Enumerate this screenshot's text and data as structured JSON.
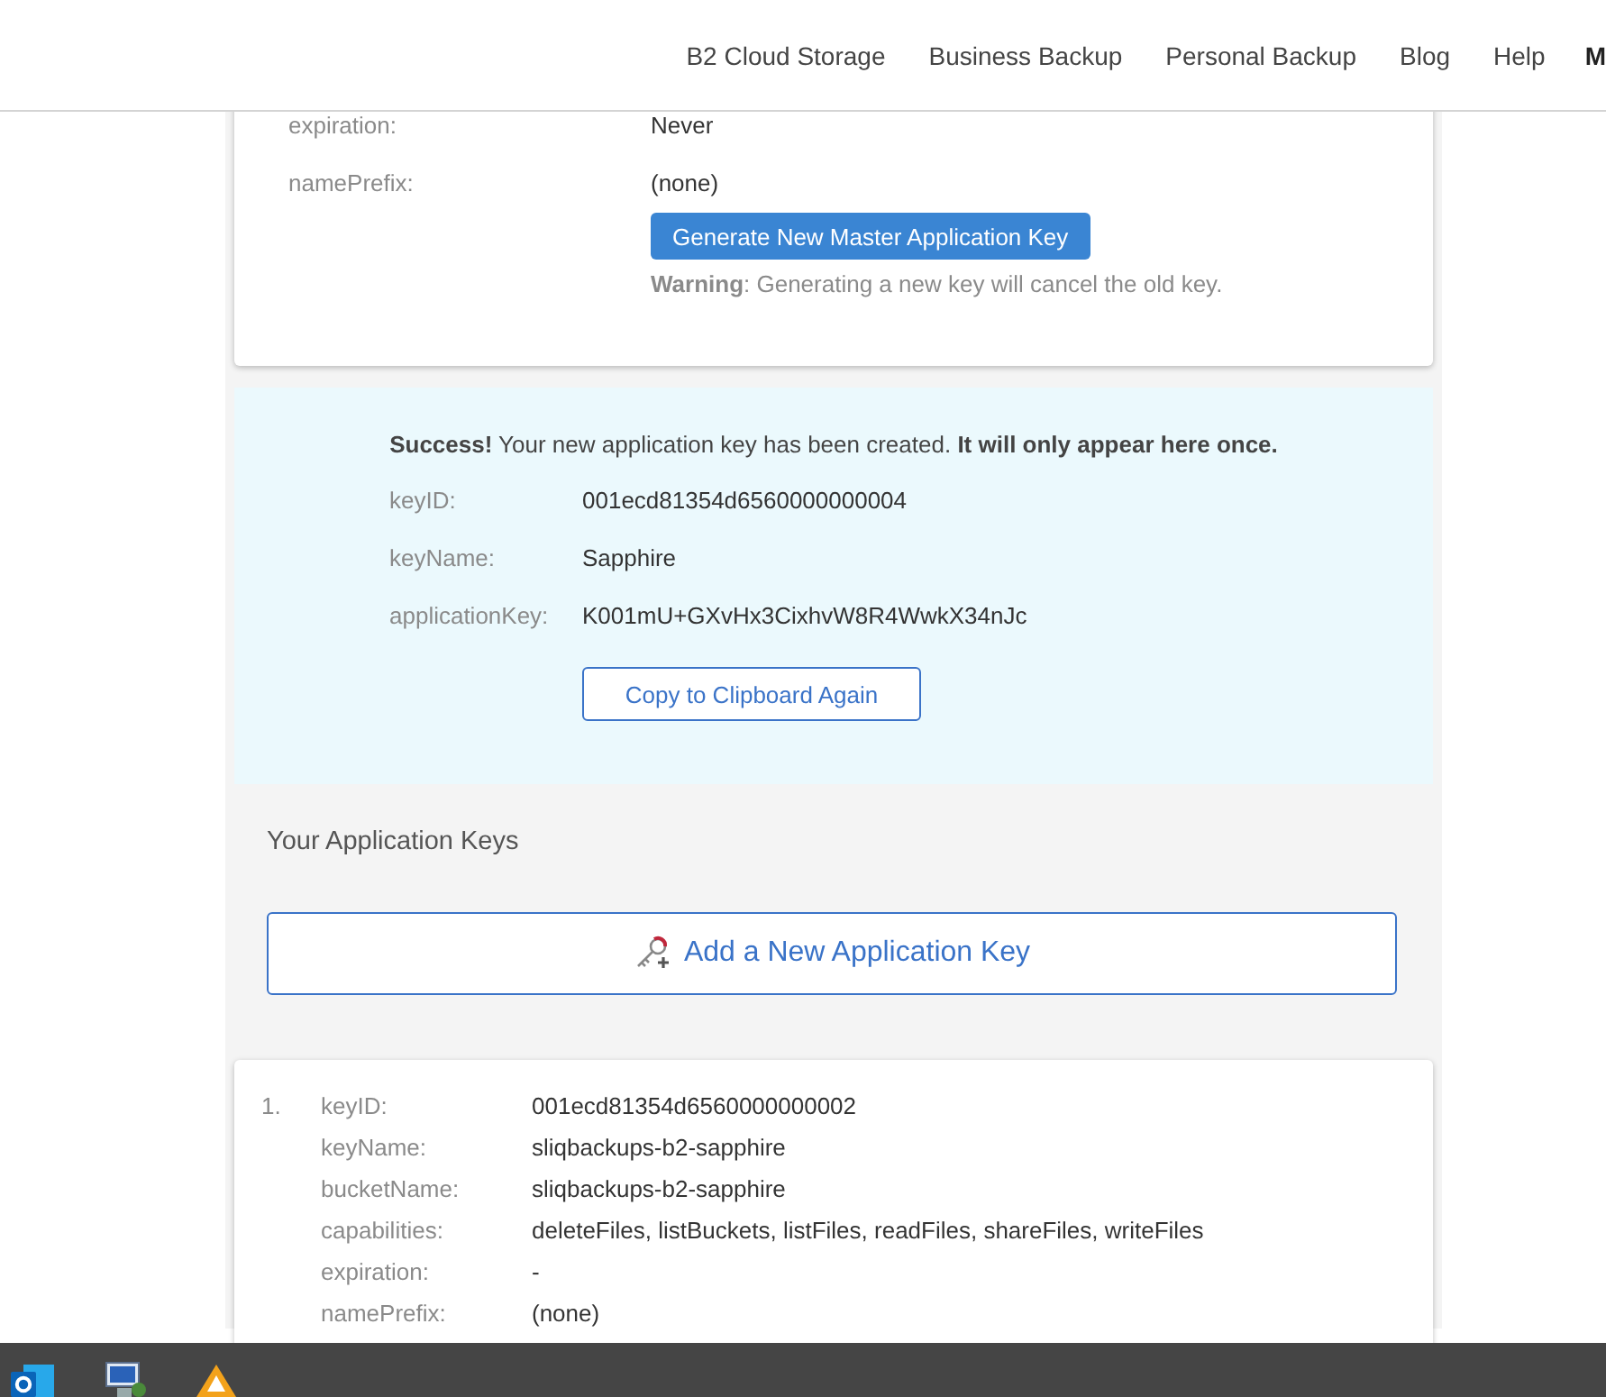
{
  "nav": {
    "links": [
      {
        "label": "B2 Cloud Storage",
        "kind": "link"
      },
      {
        "label": "Business Backup",
        "kind": "link"
      },
      {
        "label": "Personal Backup",
        "kind": "link"
      },
      {
        "label": "Blog",
        "kind": "link"
      },
      {
        "label": "Help",
        "kind": "link"
      },
      {
        "label": "M",
        "kind": "account"
      }
    ]
  },
  "master_key": {
    "rows": [
      {
        "label": "expiration:",
        "value": "Never"
      },
      {
        "label": "namePrefix:",
        "value": "(none)"
      }
    ],
    "button": "Generate New Master Application Key",
    "warning": "**Warning**: Generating a new key will cancel the old key."
  },
  "success": {
    "message": "**Success!** Your new application key has been created. **It will only appear here once.**",
    "rows": [
      {
        "label": "keyID:",
        "value": "001ecd81354d6560000000004"
      },
      {
        "label": "keyName:",
        "value": "Sapphire"
      },
      {
        "label": "applicationKey:",
        "value": "K001mU+GXvHx3CixhvW8R4WwkX34nJc"
      }
    ],
    "button": "Copy to Clipboard Again"
  },
  "keys": {
    "title": "Your Application Keys",
    "add_button": "Add a New Application Key",
    "items": [
      {
        "number": "1.",
        "rows": [
          {
            "label": "keyID:",
            "value": "001ecd81354d6560000000002"
          },
          {
            "label": "keyName:",
            "value": "sliqbackups-b2-sapphire"
          },
          {
            "label": "bucketName:",
            "value": "sliqbackups-b2-sapphire"
          },
          {
            "label": "capabilities:",
            "value": "deleteFiles, listBuckets, listFiles, readFiles, shareFiles, writeFiles"
          },
          {
            "label": "expiration:",
            "value": "-"
          },
          {
            "label": "namePrefix:",
            "value": "(none)"
          }
        ]
      }
    ]
  }
}
